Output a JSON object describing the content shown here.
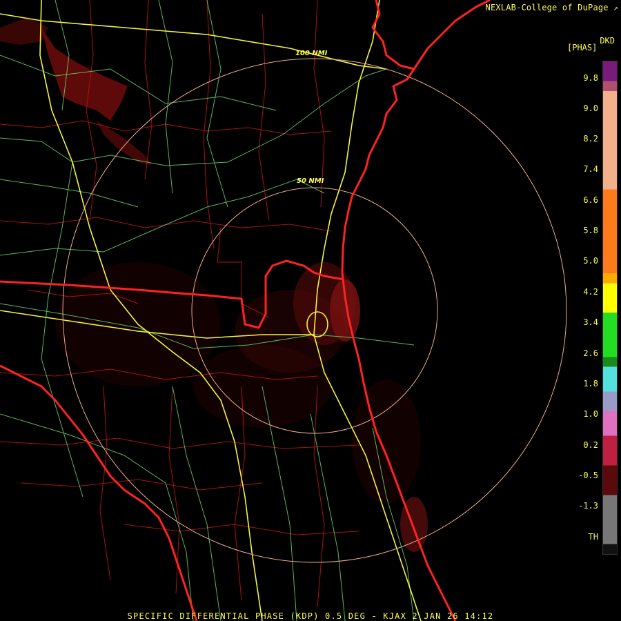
{
  "header": {
    "credit": "NEXLAB-College of DuPage",
    "product_code": "DKD",
    "units": "[PHAS]"
  },
  "rings": {
    "inner_label": "50 NMI",
    "outer_label": "100 NMI"
  },
  "legend": {
    "ticks": [
      "9.8",
      "9.0",
      "8.2",
      "7.4",
      "6.6",
      "5.8",
      "5.0",
      "4.2",
      "3.4",
      "2.6",
      "1.8",
      "1.0",
      "0.2",
      "-0.5",
      "-1.3",
      "TH"
    ],
    "colors": {
      "purple_top": "#7a1a7a",
      "peach": "#f4b08a",
      "orange": "#ff7a1a",
      "yellow": "#ffff00",
      "green": "#22dd22",
      "cyan": "#55e0e0",
      "lavender": "#9a9ac8",
      "pink": "#e070c0",
      "red": "#c02040",
      "dark_red": "#5a0a0a",
      "gray": "#777777"
    }
  },
  "map_colors": {
    "coastline": "#ff2020",
    "county": "#c01818",
    "highway": "#ffff33",
    "road": "#66dd66",
    "ring": "#f0b090",
    "echo": "#7a1010"
  },
  "footer": {
    "caption": "SPECIFIC DIFFERENTIAL PHASE (KDP) 0.5 DEG - KJAX 2 JAN 26 14:12"
  }
}
